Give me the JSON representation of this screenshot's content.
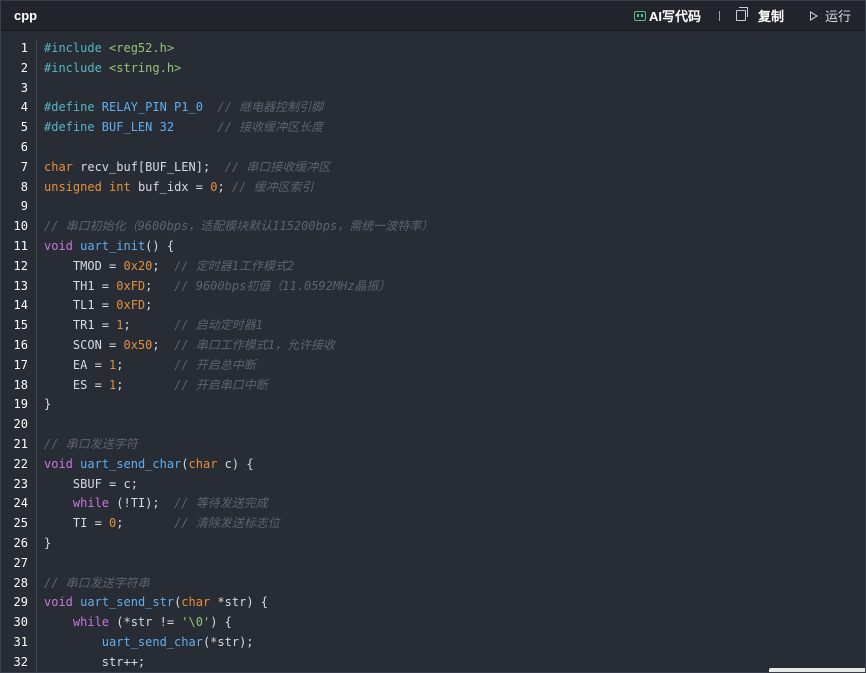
{
  "header": {
    "language": "cpp",
    "ai_label": "AI写代码",
    "copy_label": "复制",
    "run_label": "运行"
  },
  "colors": {
    "background": "#282c34",
    "keyword": "#c678dd",
    "type": "#e5903b",
    "function": "#61afef",
    "string": "#98c379",
    "comment": "#5c6370",
    "ai_icon": "#4cc38a"
  },
  "icons": {
    "ai": "ai-code-icon",
    "copy": "copy-icon",
    "run": "play-icon"
  },
  "line_numbers": [
    "1",
    "2",
    "3",
    "4",
    "5",
    "6",
    "7",
    "8",
    "9",
    "10",
    "11",
    "12",
    "13",
    "14",
    "15",
    "16",
    "17",
    "18",
    "19",
    "20",
    "21",
    "22",
    "23",
    "24",
    "25",
    "26",
    "27",
    "28",
    "29",
    "30",
    "31",
    "32"
  ],
  "code_lines": [
    [
      [
        "pp",
        "#include "
      ],
      [
        "inc",
        "<reg52.h>"
      ]
    ],
    [
      [
        "pp",
        "#include "
      ],
      [
        "inc",
        "<string.h>"
      ]
    ],
    [],
    [
      [
        "pp",
        "#define "
      ],
      [
        "mac",
        "RELAY_PIN P1_0"
      ],
      [
        "id",
        "  "
      ],
      [
        "cm",
        "// 继电器控制引脚"
      ]
    ],
    [
      [
        "pp",
        "#define "
      ],
      [
        "mac",
        "BUF_LEN 32"
      ],
      [
        "id",
        "      "
      ],
      [
        "cm",
        "// 接收缓冲区长度"
      ]
    ],
    [],
    [
      [
        "ty",
        "char"
      ],
      [
        "id",
        " recv_buf[BUF_LEN];  "
      ],
      [
        "cm",
        "// 串口接收缓冲区"
      ]
    ],
    [
      [
        "ty",
        "unsigned"
      ],
      [
        "id",
        " "
      ],
      [
        "ty",
        "int"
      ],
      [
        "id",
        " buf_idx = "
      ],
      [
        "num",
        "0"
      ],
      [
        "id",
        "; "
      ],
      [
        "cm",
        "// 缓冲区索引"
      ]
    ],
    [],
    [
      [
        "cm",
        "// 串口初始化（9600bps，适配模块默认115200bps，需统一波特率）"
      ]
    ],
    [
      [
        "kw",
        "void"
      ],
      [
        "id",
        " "
      ],
      [
        "fn",
        "uart_init"
      ],
      [
        "id",
        "() {"
      ]
    ],
    [
      [
        "id",
        "    TMOD = "
      ],
      [
        "num",
        "0x20"
      ],
      [
        "id",
        ";  "
      ],
      [
        "cm",
        "// 定时器1工作模式2"
      ]
    ],
    [
      [
        "id",
        "    TH1 = "
      ],
      [
        "num",
        "0xFD"
      ],
      [
        "id",
        ";   "
      ],
      [
        "cm",
        "// 9600bps初值（11.0592MHz晶振）"
      ]
    ],
    [
      [
        "id",
        "    TL1 = "
      ],
      [
        "num",
        "0xFD"
      ],
      [
        "id",
        ";"
      ]
    ],
    [
      [
        "id",
        "    TR1 = "
      ],
      [
        "num",
        "1"
      ],
      [
        "id",
        ";      "
      ],
      [
        "cm",
        "// 启动定时器1"
      ]
    ],
    [
      [
        "id",
        "    SCON = "
      ],
      [
        "num",
        "0x50"
      ],
      [
        "id",
        ";  "
      ],
      [
        "cm",
        "// 串口工作模式1，允许接收"
      ]
    ],
    [
      [
        "id",
        "    EA = "
      ],
      [
        "num",
        "1"
      ],
      [
        "id",
        ";       "
      ],
      [
        "cm",
        "// 开启总中断"
      ]
    ],
    [
      [
        "id",
        "    ES = "
      ],
      [
        "num",
        "1"
      ],
      [
        "id",
        ";       "
      ],
      [
        "cm",
        "// 开启串口中断"
      ]
    ],
    [
      [
        "id",
        "}"
      ]
    ],
    [],
    [
      [
        "cm",
        "// 串口发送字符"
      ]
    ],
    [
      [
        "kw",
        "void"
      ],
      [
        "id",
        " "
      ],
      [
        "fn",
        "uart_send_char"
      ],
      [
        "id",
        "("
      ],
      [
        "ty",
        "char"
      ],
      [
        "id",
        " c) {"
      ]
    ],
    [
      [
        "id",
        "    SBUF = c;"
      ]
    ],
    [
      [
        "id",
        "    "
      ],
      [
        "kw",
        "while"
      ],
      [
        "id",
        " (!TI);  "
      ],
      [
        "cm",
        "// 等待发送完成"
      ]
    ],
    [
      [
        "id",
        "    TI = "
      ],
      [
        "num",
        "0"
      ],
      [
        "id",
        ";       "
      ],
      [
        "cm",
        "// 清除发送标志位"
      ]
    ],
    [
      [
        "id",
        "}"
      ]
    ],
    [],
    [
      [
        "cm",
        "// 串口发送字符串"
      ]
    ],
    [
      [
        "kw",
        "void"
      ],
      [
        "id",
        " "
      ],
      [
        "fn",
        "uart_send_str"
      ],
      [
        "id",
        "("
      ],
      [
        "ty",
        "char"
      ],
      [
        "id",
        " *str) {"
      ]
    ],
    [
      [
        "id",
        "    "
      ],
      [
        "kw",
        "while"
      ],
      [
        "id",
        " (*str != "
      ],
      [
        "str",
        "'\\0'"
      ],
      [
        "id",
        ") {"
      ]
    ],
    [
      [
        "id",
        "        "
      ],
      [
        "fn",
        "uart_send_char"
      ],
      [
        "id",
        "(*str);"
      ]
    ],
    [
      [
        "id",
        "        str++;"
      ]
    ]
  ]
}
